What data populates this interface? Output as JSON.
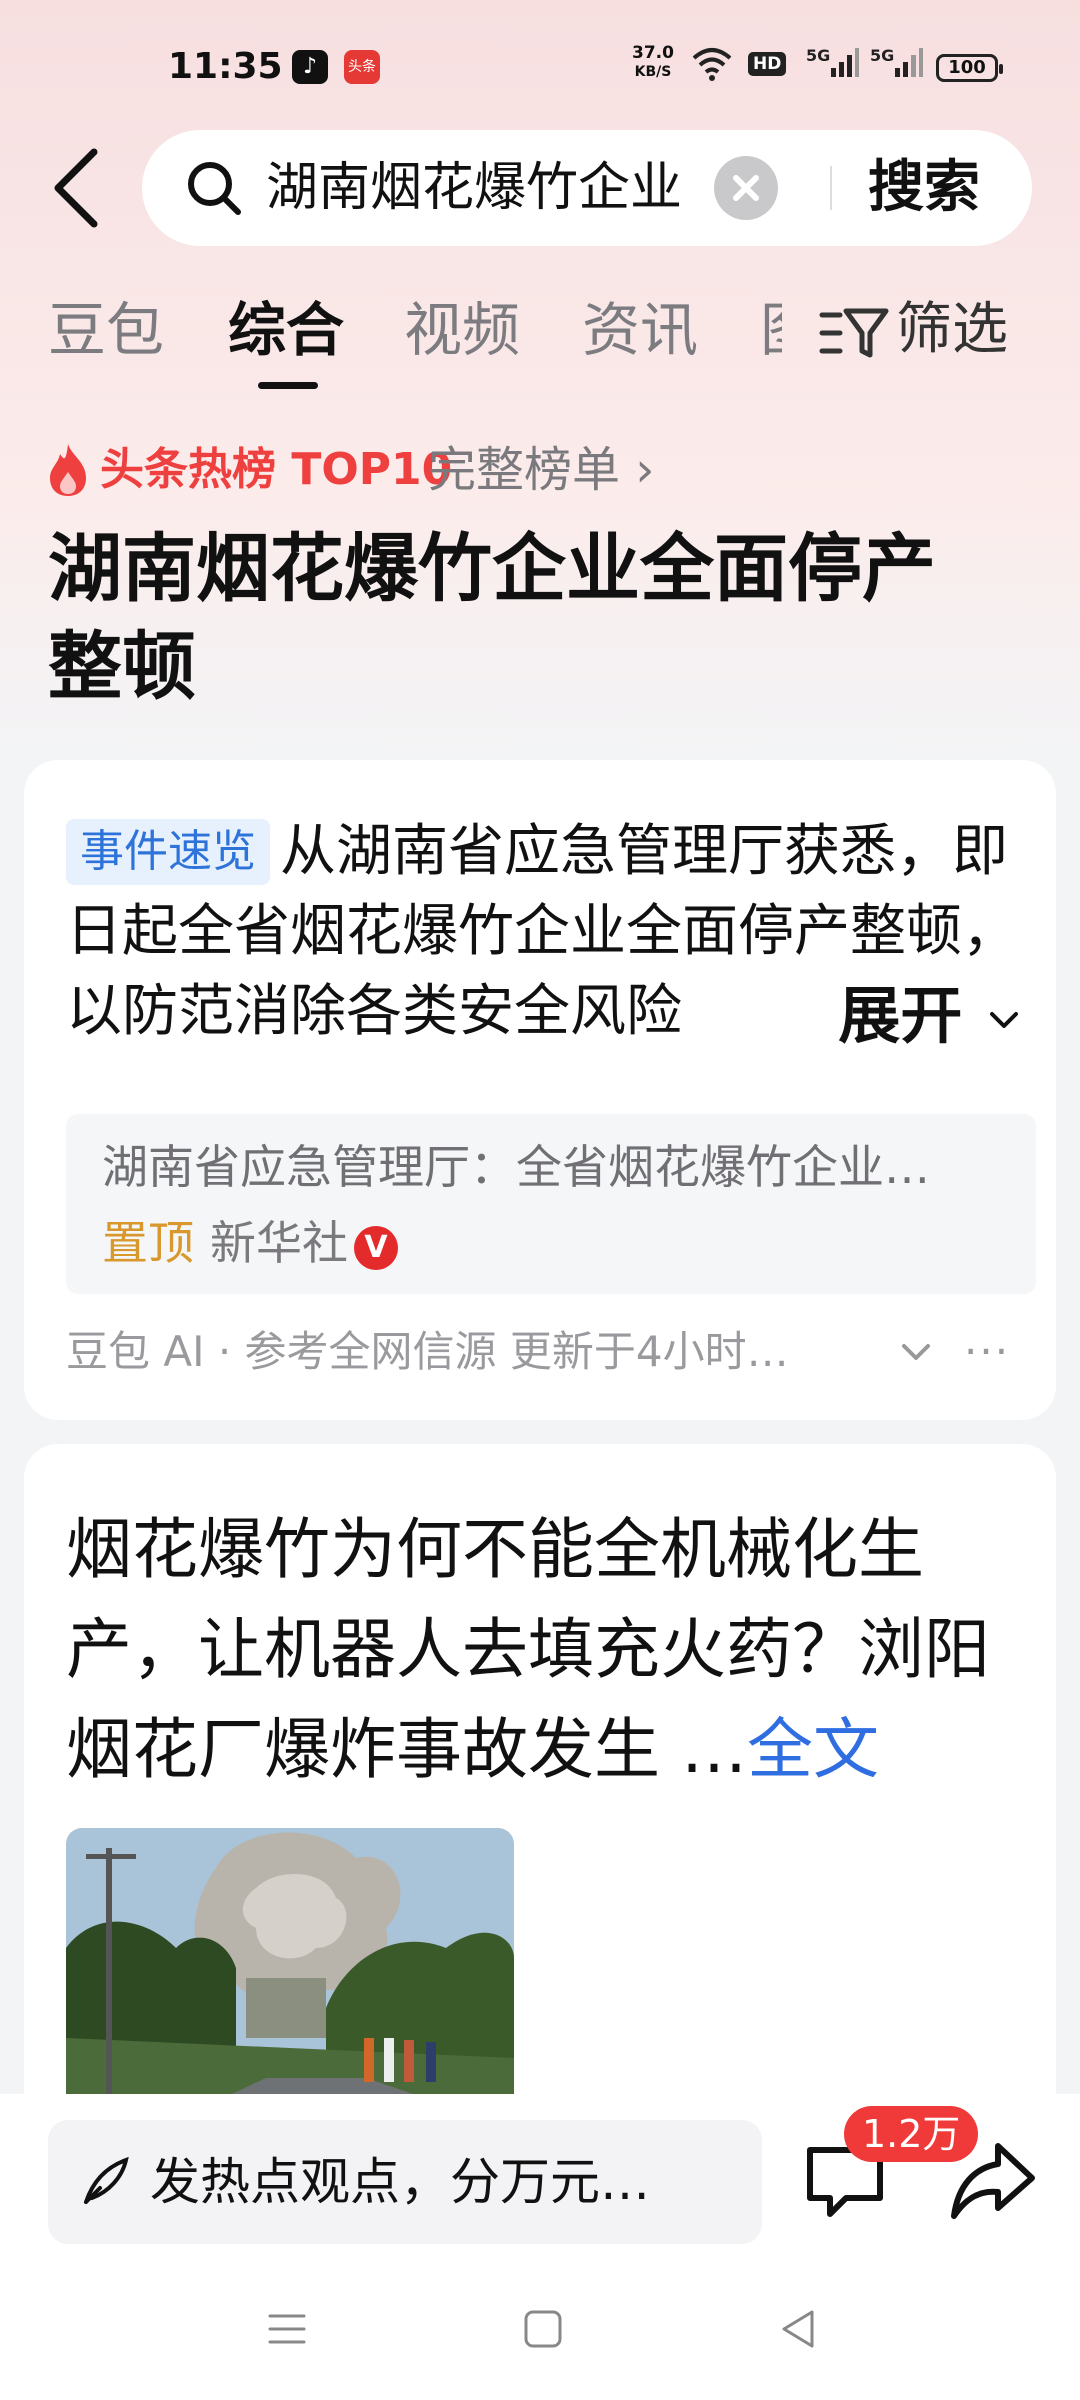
{
  "status_bar": {
    "time": "11:35",
    "app_icon_1": "tiktok-icon",
    "app_icon_2": "toutiao-icon",
    "net_speed_value": "37.0",
    "net_speed_unit": "KB/S",
    "hd_badge": "HD",
    "signal_1": "5G",
    "signal_2": "5G",
    "battery": "100"
  },
  "search": {
    "query": "湖南烟花爆竹企业",
    "submit_label": "搜索"
  },
  "tabs": {
    "items": [
      "豆包",
      "综合",
      "视频",
      "资讯",
      "图"
    ],
    "active_index": 1,
    "filter_label": "筛选"
  },
  "hot": {
    "label": "头条热榜 TOP10",
    "full_list_label": "完整榜单 ›"
  },
  "topic": {
    "title": "湖南烟花爆竹企业全面停产整顿"
  },
  "summary_card": {
    "tag": "事件速览",
    "text": "从湖南省应急管理厅获悉，即日起全省烟花爆竹企业全面停产整顿，以防范消除各类安全风险",
    "expand_label": "展开",
    "source_title": "湖南省应急管理厅：全省烟花爆竹企业…",
    "pin_label": "置顶",
    "publisher": "新华社",
    "verified_mark": "V",
    "footer": "豆包 AI · 参考全网信源 更新于4小时…",
    "more_label": "···"
  },
  "news_card": {
    "headline": "烟花爆竹为何不能全机械化生产，让机器人去填充火药？浏阳烟花厂爆炸事故发生 …",
    "read_more": "全文"
  },
  "bottom_bar": {
    "comment_placeholder": "发热点观点，分万元…",
    "comment_count": "1.2万"
  },
  "colors": {
    "hot_red": "#ef4040",
    "link_blue": "#2f6ee0",
    "tag_blue": "#2d73d9",
    "pin_gold": "#d8982d"
  }
}
